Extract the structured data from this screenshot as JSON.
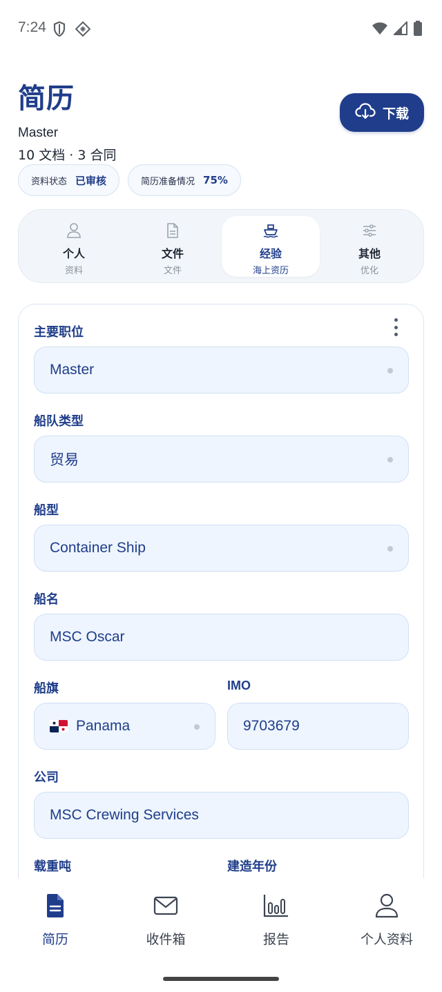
{
  "status_bar": {
    "time": "7:24",
    "left_icons": [
      "shield-icon",
      "vpn-grid-icon"
    ],
    "right_icons": [
      "wifi-icon",
      "signal-icon",
      "battery-icon"
    ]
  },
  "header": {
    "title": "简历",
    "subtitle": "Master",
    "meta": "10 文档 · 3 合同",
    "download_label": "下载",
    "download_icon": "cloud-download-icon"
  },
  "chips": [
    {
      "label": "资料状态",
      "value": "已审核"
    },
    {
      "label": "简历准备情况",
      "value": "75%"
    }
  ],
  "tabs": [
    {
      "title": "个人",
      "subtitle": "资料",
      "icon": "person-icon",
      "active": false
    },
    {
      "title": "文件",
      "subtitle": "文件",
      "icon": "document-icon",
      "active": false
    },
    {
      "title": "经验",
      "subtitle": "海上资历",
      "icon": "ship-icon",
      "active": true
    },
    {
      "title": "其他",
      "subtitle": "优化",
      "icon": "sliders-icon",
      "active": false
    }
  ],
  "form": {
    "main_position": {
      "label": "主要职位",
      "value": "Master"
    },
    "fleet_type": {
      "label": "船队类型",
      "value": "贸易"
    },
    "ship_type": {
      "label": "船型",
      "value": "Container Ship"
    },
    "ship_name": {
      "label": "船名",
      "value": "MSC Oscar"
    },
    "flag": {
      "label": "船旗",
      "value": "Panama"
    },
    "imo": {
      "label": "IMO",
      "value": "9703679"
    },
    "company": {
      "label": "公司",
      "value": "MSC Crewing Services"
    },
    "deadweight": {
      "label": "载重吨"
    },
    "build_year": {
      "label": "建造年份"
    }
  },
  "bottom_nav": [
    {
      "label": "简历",
      "icon": "resume-icon",
      "active": true
    },
    {
      "label": "收件箱",
      "icon": "mail-icon",
      "active": false
    },
    {
      "label": "报告",
      "icon": "bar-chart-icon",
      "active": false
    },
    {
      "label": "个人资料",
      "icon": "profile-icon",
      "active": false
    }
  ],
  "colors": {
    "primary": "#1f3d8a",
    "field_bg": "#eef5fe",
    "field_border": "#cfe0f5"
  }
}
